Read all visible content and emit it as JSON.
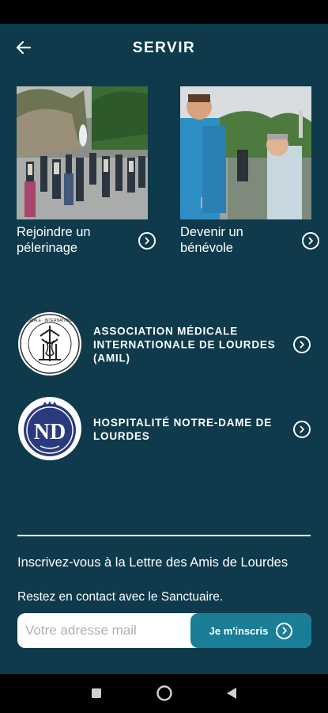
{
  "header": {
    "title": "SERVIR",
    "back_icon": "arrow-left-icon"
  },
  "cards": [
    {
      "label": "Rejoindre un pélerinage"
    },
    {
      "label": "Devenir un bénévole"
    }
  ],
  "organizations": [
    {
      "label": "ASSOCIATION MÉDICALE INTERNATIONALE DE LOURDES (AMIL)",
      "logo_text": "MEDICALE INTERNATIONALE · LOURDES · 1958"
    },
    {
      "label": "HOSPITALITÉ NOTRE-DAME DE LOURDES"
    }
  ],
  "newsletter": {
    "title": "Inscrivez-vous à la Lettre des Amis de Lourdes",
    "subtitle": "Restez en contact avec le Sanctuaire.",
    "email_placeholder": "Votre adresse mail",
    "subscribe_label": "Je m'inscris"
  },
  "colors": {
    "background": "#0e3a4c",
    "accent": "#1a7e97",
    "logo_blue": "#2a3a7c"
  }
}
